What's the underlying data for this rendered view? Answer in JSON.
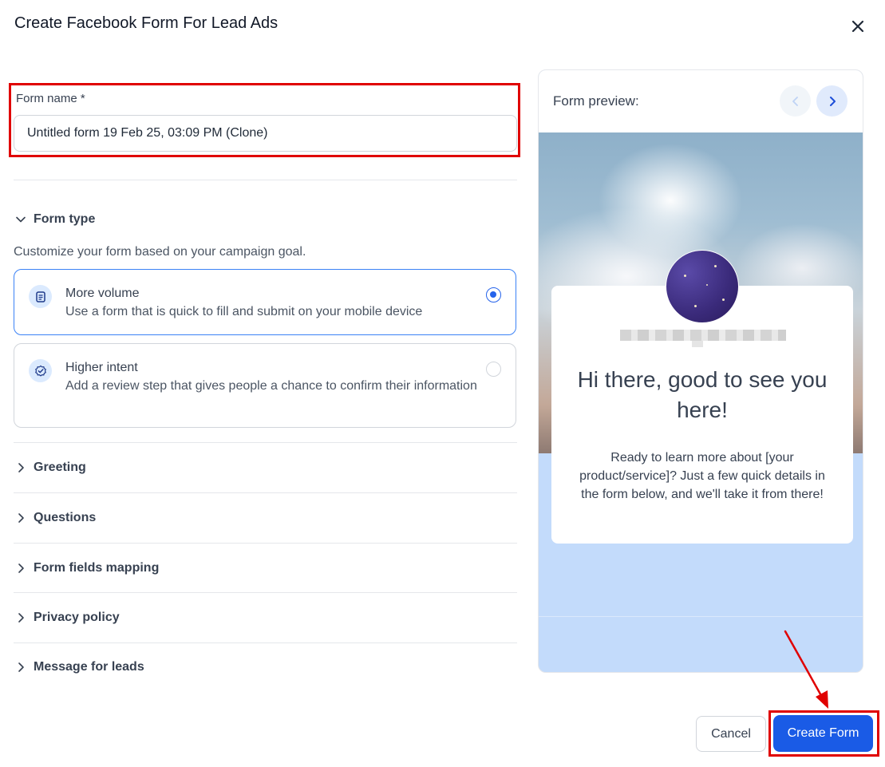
{
  "modal": {
    "title": "Create Facebook Form For Lead Ads"
  },
  "form_name": {
    "label": "Form name *",
    "value": "Untitled form 19 Feb 25, 03:09 PM (Clone)"
  },
  "form_type": {
    "heading": "Form type",
    "description": "Customize your form based on your campaign goal.",
    "options": [
      {
        "title": "More volume",
        "description": "Use a form that is quick to fill and submit on your mobile device",
        "selected": true,
        "icon": "list-doc-icon"
      },
      {
        "title": "Higher intent",
        "description": "Add a review step that gives people a chance to confirm their information",
        "selected": false,
        "icon": "check-badge-icon"
      }
    ]
  },
  "sections": [
    {
      "label": "Greeting"
    },
    {
      "label": "Questions"
    },
    {
      "label": "Form fields mapping"
    },
    {
      "label": "Privacy policy"
    },
    {
      "label": "Message for leads"
    }
  ],
  "preview": {
    "title": "Form preview:",
    "greeting_heading": "Hi there, good to see you here!",
    "greeting_body": "Ready to learn more about [your product/service]? Just a few quick details in the form below, and we'll take it from there!"
  },
  "footer": {
    "cancel_label": "Cancel",
    "create_label": "Create Form"
  },
  "colors": {
    "accent": "#1a5be6",
    "highlight": "#e00000",
    "selected_border": "#3b82f6"
  }
}
